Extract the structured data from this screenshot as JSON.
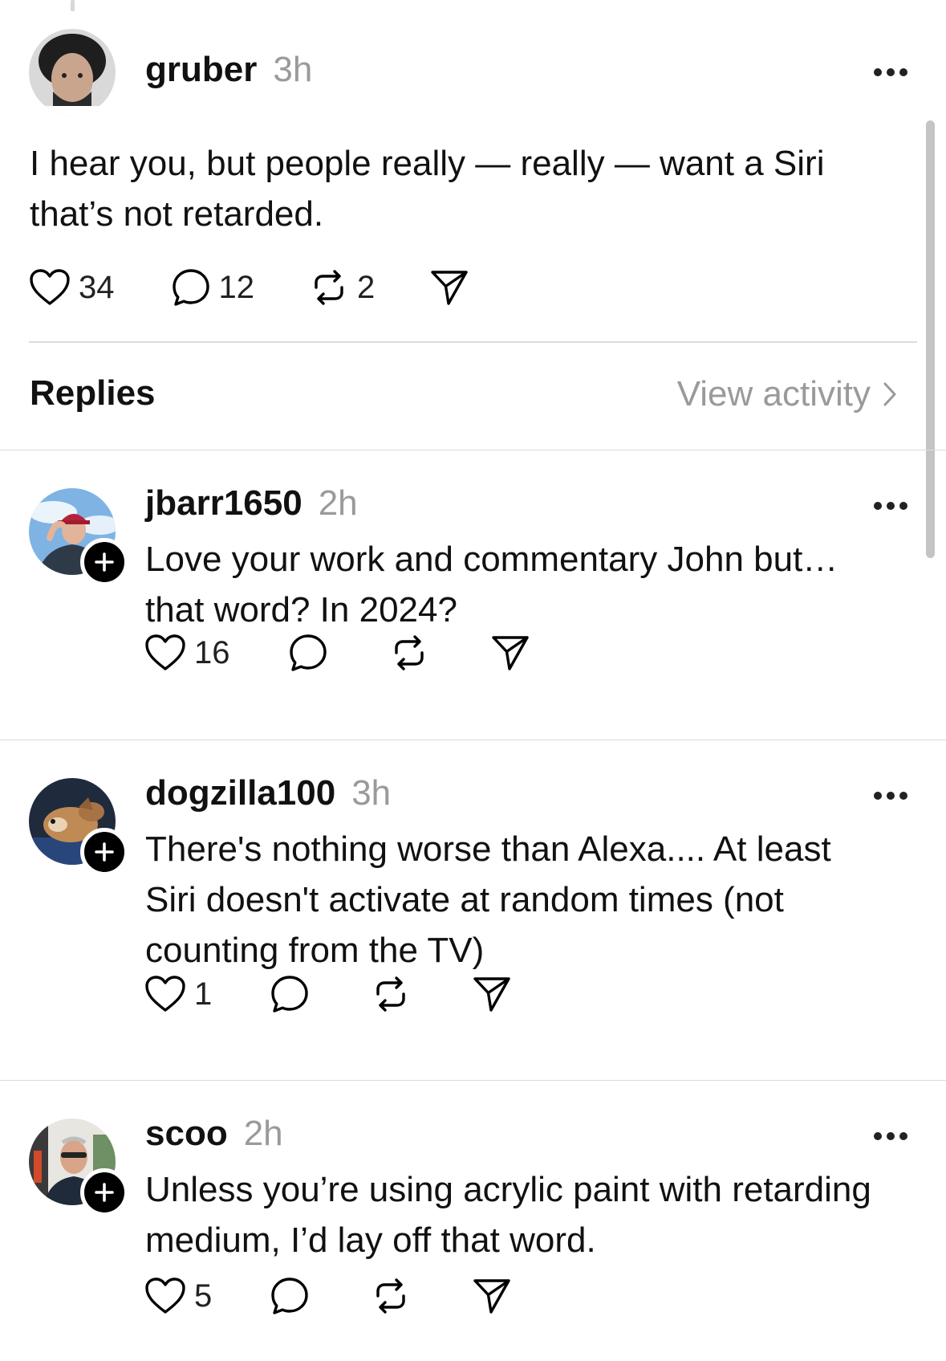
{
  "main_post": {
    "username": "gruber",
    "time": "3h",
    "text_line1": "I hear you, but people really — really — want a Siri",
    "text_line2": "that’s not retarded.",
    "likes": "34",
    "comments": "12",
    "reposts": "2"
  },
  "replies_section": {
    "label": "Replies",
    "view_activity": "View activity"
  },
  "replies": [
    {
      "username": "jbarr1650",
      "time": "2h",
      "lines": [
        "Love your work and commentary John but…",
        "that word? In 2024?"
      ],
      "likes": "16"
    },
    {
      "username": "dogzilla100",
      "time": "3h",
      "lines": [
        "There's nothing worse than Alexa.... At least",
        "Siri doesn't activate at random times (not",
        "counting from the TV)"
      ],
      "likes": "1"
    },
    {
      "username": "scoo",
      "time": "2h",
      "lines": [
        "Unless you’re using acrylic paint with retarding",
        "medium, I’d lay off that word."
      ],
      "likes": "5"
    }
  ],
  "icons": {
    "like": "heart-icon",
    "comment": "comment-bubble-icon",
    "repost": "repost-icon",
    "share": "share-send-icon",
    "more": "more-dots-icon",
    "follow": "plus-icon",
    "chevron": "chevron-right-icon"
  },
  "colors": {
    "text": "#111111",
    "muted": "#9a9a9a",
    "divider": "#dcdcdc"
  }
}
